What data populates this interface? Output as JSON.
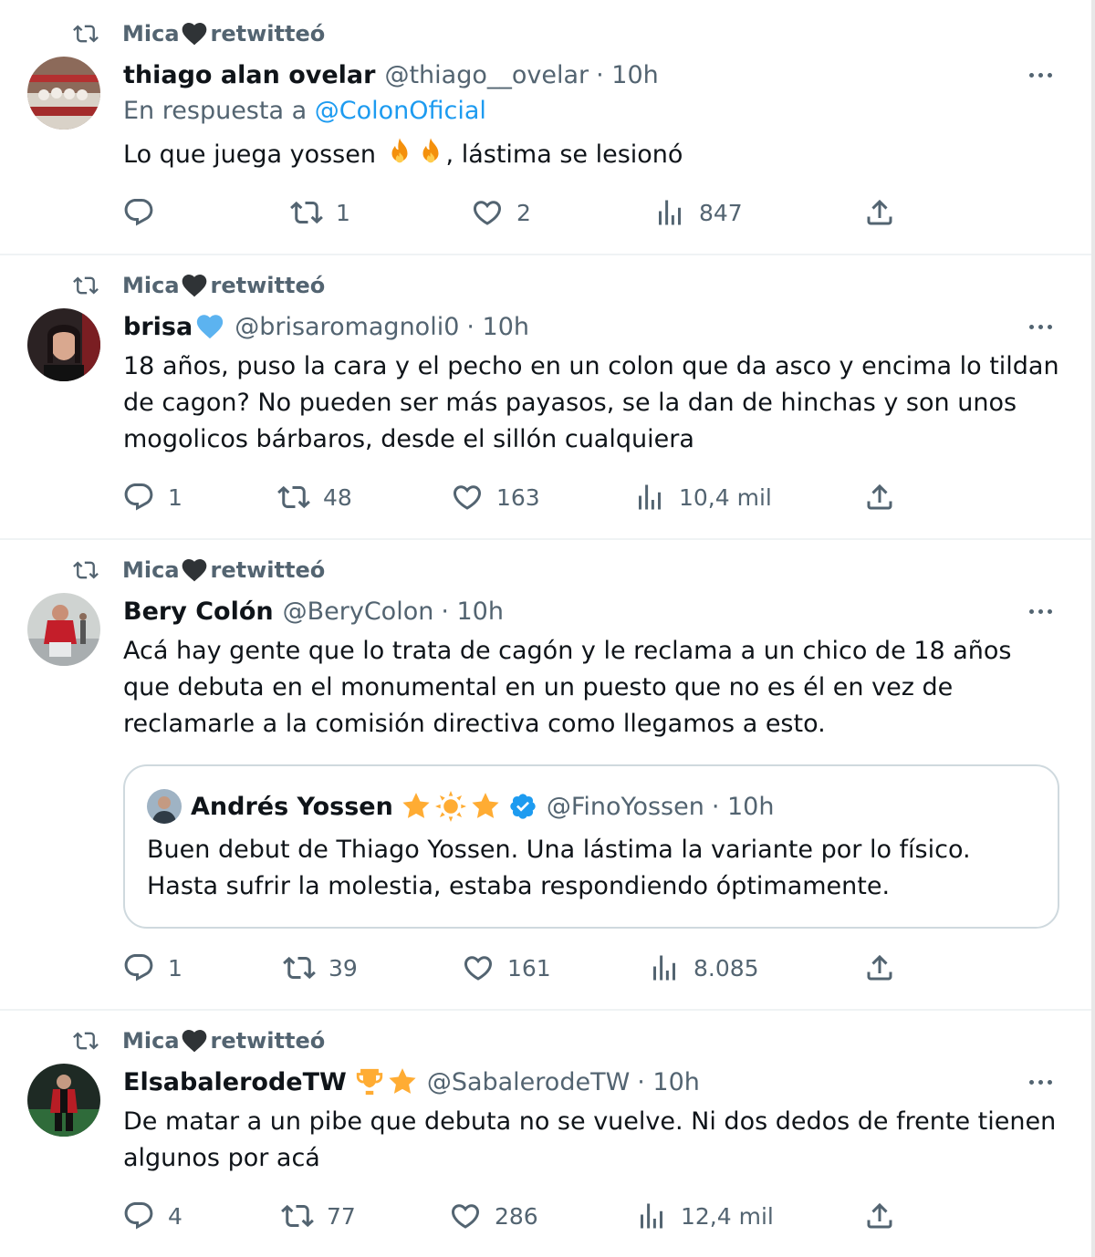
{
  "colors": {
    "text": "#0f1419",
    "secondary": "#536471",
    "link": "#1d9bf0",
    "border": "#cfd9de",
    "verified": "#1d9bf0"
  },
  "tweets": [
    {
      "retweeted_by": "Mica",
      "retweeted_label": "retwitteó",
      "name": "thiago alan ovelar",
      "handle": "@thiago__ovelar",
      "time": "· 10h",
      "reply_prefix": "En respuesta a ",
      "reply_mention": "@ColonOficial",
      "text_before": "Lo que juega yossen ",
      "text_after": ", lástima se lesionó",
      "reply_count": "",
      "retweet_count": "1",
      "like_count": "2",
      "view_count": "847"
    },
    {
      "retweeted_by": "Mica",
      "retweeted_label": "retwitteó",
      "name": "brisa",
      "handle": "@brisaromagnoli0",
      "time": "· 10h",
      "text": "18 años, puso la cara y el pecho en un colon que da asco y encima lo tildan de cagon? No pueden ser más payasos, se la dan de hinchas y son unos mogolicos bárbaros, desde el sillón cualquiera",
      "reply_count": "1",
      "retweet_count": "48",
      "like_count": "163",
      "view_count": "10,4 mil"
    },
    {
      "retweeted_by": "Mica",
      "retweeted_label": "retwitteó",
      "name": "Bery Colón",
      "handle": "@BeryColon",
      "time": "· 10h",
      "text": "Acá hay gente que lo trata de cagón y le reclama a un chico de 18 años que debuta en el monumental en un puesto que no es él en vez de reclamarle a la comisión directiva como llegamos a esto.",
      "quote": {
        "name": "Andrés Yossen",
        "handle": "@FinoYossen",
        "time": "· 10h",
        "text": "Buen debut de Thiago Yossen. Una lástima la variante por lo físico. Hasta sufrir la molestia, estaba respondiendo óptimamente."
      },
      "reply_count": "1",
      "retweet_count": "39",
      "like_count": "161",
      "view_count": "8.085"
    },
    {
      "retweeted_by": "Mica",
      "retweeted_label": "retwitteó",
      "name": "ElsabalerodeTW",
      "handle": "@SabalerodeTW",
      "time": "· 10h",
      "text": "De matar a un pibe que debuta no se vuelve. Ni dos dedos de frente tienen algunos por acá",
      "reply_count": "4",
      "retweet_count": "77",
      "like_count": "286",
      "view_count": "12,4 mil"
    }
  ]
}
